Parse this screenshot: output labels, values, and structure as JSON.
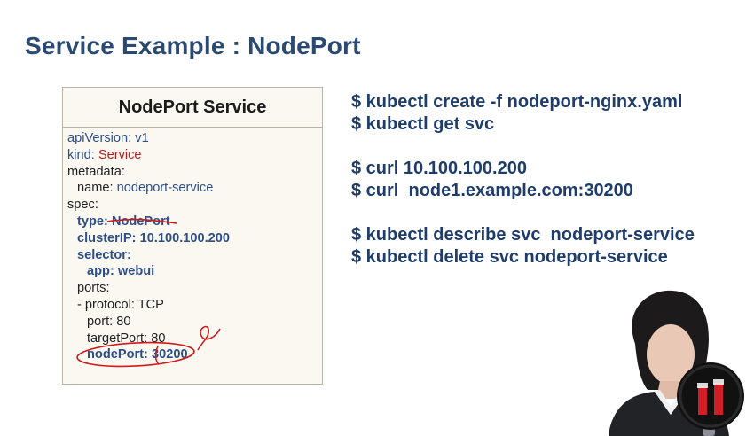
{
  "slide": {
    "title": "Service Example : NodePort"
  },
  "yaml_box": {
    "title": "NodePort Service",
    "lines": [
      {
        "key": "apiVersion:",
        "value": "v1"
      },
      {
        "key": "kind:",
        "value": "Service"
      },
      {
        "key": "metadata:",
        "value": ""
      },
      {
        "key": "name:",
        "value": "nodeport-service"
      },
      {
        "key": "spec:",
        "value": ""
      },
      {
        "key": "type:",
        "value": "NodePort"
      },
      {
        "key": "clusterIP:",
        "value": "10.100.100.200"
      },
      {
        "key": "selector:",
        "value": ""
      },
      {
        "key": "app:",
        "value": "webui"
      },
      {
        "key": "ports:",
        "value": ""
      },
      {
        "key": "- protocol:",
        "value": "TCP"
      },
      {
        "key": "port:",
        "value": "80"
      },
      {
        "key": "targetPort:",
        "value": "80"
      },
      {
        "key": "nodePort:",
        "value": "30200"
      }
    ]
  },
  "commands": {
    "group1": [
      "$ kubectl create -f nodeport-nginx.yaml",
      "$ kubectl get svc"
    ],
    "group2": [
      "$ curl 10.100.100.200",
      "$ curl  node1.example.com:30200"
    ],
    "group3": [
      "$ kubectl describe svc  nodeport-service",
      "$ kubectl delete svc nodeport-service"
    ]
  },
  "colors": {
    "title": "#2a4a72",
    "yaml_key_blue": "#2e4f86",
    "yaml_value_red": "#b02020",
    "annotation": "#d01818",
    "commands": "#1f3d6b"
  },
  "icons": {
    "presenter": "presenter-video",
    "logo": "channel-logo"
  }
}
